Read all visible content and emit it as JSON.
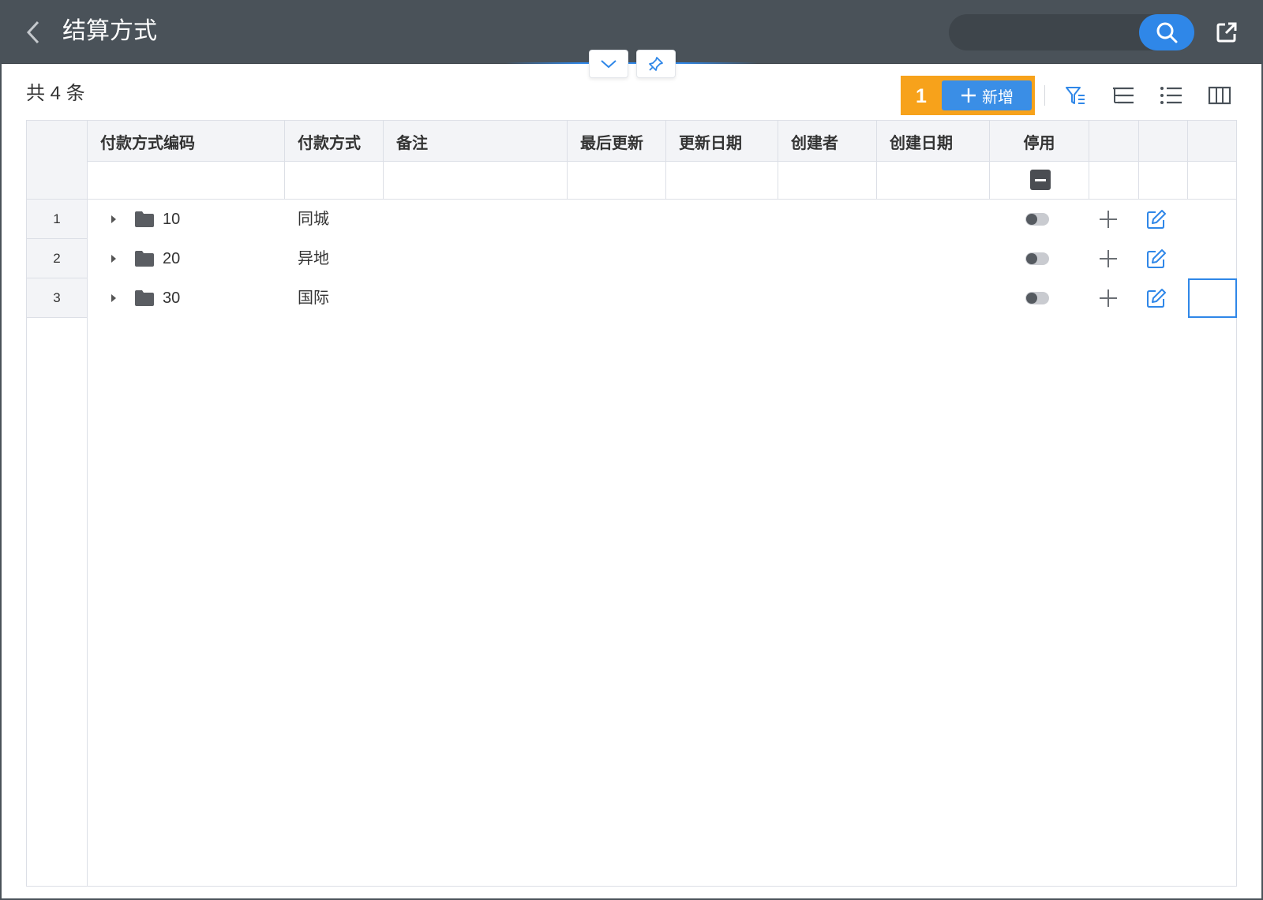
{
  "header": {
    "title": "结算方式",
    "back_icon": "chevron-left-icon",
    "search_placeholder": "",
    "search_icon": "search-icon",
    "export_icon": "share-export-icon"
  },
  "toolbar": {
    "record_count": "共 4 条",
    "highlight_number": "1",
    "add_label": "新增",
    "icons": [
      "filter-icon",
      "tree-list-icon",
      "list-icon",
      "columns-icon"
    ]
  },
  "table": {
    "columns": [
      "付款方式编码",
      "付款方式",
      "备注",
      "最后更新",
      "更新日期",
      "创建者",
      "创建日期",
      "停用"
    ],
    "rows": [
      {
        "index": "1",
        "code": "10",
        "method": "同城",
        "disabled": false
      },
      {
        "index": "2",
        "code": "20",
        "method": "异地",
        "disabled": false
      },
      {
        "index": "3",
        "code": "30",
        "method": "国际",
        "disabled": false
      }
    ]
  },
  "colors": {
    "header_bg": "#4a5259",
    "accent": "#2f87e8",
    "highlight": "#f7a21b"
  }
}
